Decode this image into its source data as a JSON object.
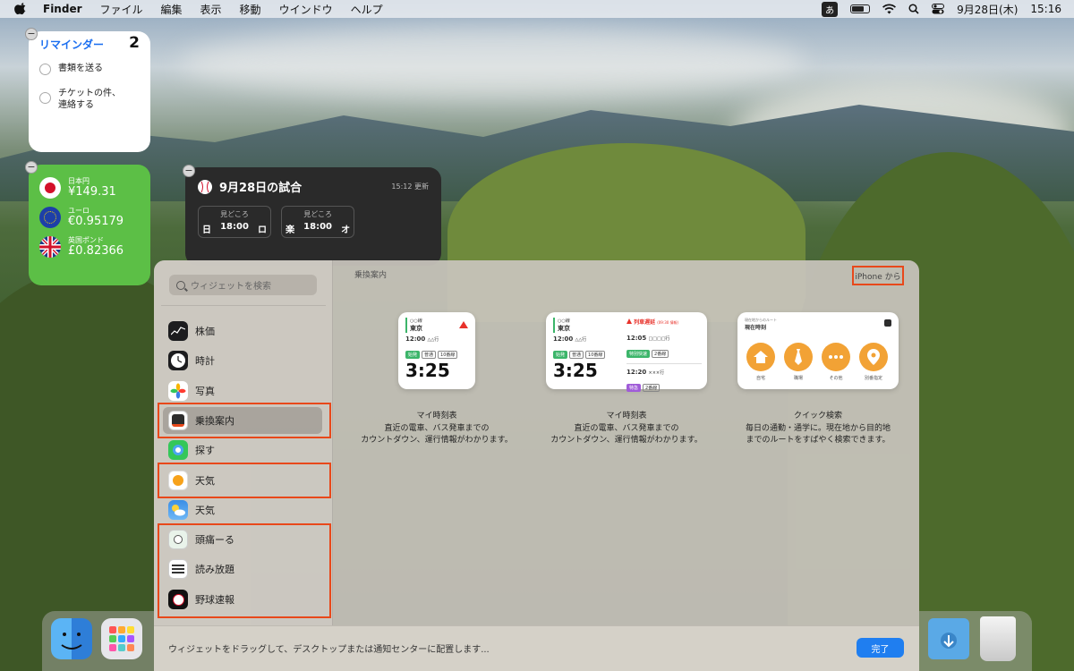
{
  "menubar": {
    "app_name": "Finder",
    "menus": [
      "ファイル",
      "編集",
      "表示",
      "移動",
      "ウインドウ",
      "ヘルプ"
    ],
    "ime": "あ",
    "date": "9月28日(木)",
    "time": "15:16"
  },
  "reminders_widget": {
    "title": "リマインダー",
    "count": "2",
    "items": [
      "書類を送る",
      "チケットの件、\n連絡する"
    ]
  },
  "currency_widget": {
    "rows": [
      {
        "name": "日本円",
        "value": "¥149.31"
      },
      {
        "name": "ユーロ",
        "value": "€0.95179"
      },
      {
        "name": "英国ポンド",
        "value": "£0.82366"
      }
    ]
  },
  "baseball_widget": {
    "title": "9月28日の試合",
    "updated": "15:12 更新",
    "matches": [
      {
        "label": "見どころ",
        "team1": "日",
        "time": "18:00",
        "team2": "ロ"
      },
      {
        "label": "見どころ",
        "team1": "楽",
        "time": "18:00",
        "team2": "オ"
      }
    ]
  },
  "gallery": {
    "search_placeholder": "ウィジェットを検索",
    "sidebar": [
      {
        "label": "株価",
        "icon": "stocks-icon",
        "color": "#1c1c1e"
      },
      {
        "label": "時計",
        "icon": "clock-icon",
        "color": "#1c1c1e"
      },
      {
        "label": "写真",
        "icon": "photos-icon",
        "color": "#ffffff"
      },
      {
        "label": "乗換案内",
        "icon": "transit-icon",
        "color": "#2d2d2d"
      },
      {
        "label": "探す",
        "icon": "findmy-icon",
        "color": "#34c759"
      },
      {
        "label": "天気",
        "icon": "yahoo-weather-icon",
        "color": "#ffffff"
      },
      {
        "label": "天気",
        "icon": "weather-icon",
        "color": "#3a8ee6"
      },
      {
        "label": "頭痛ーる",
        "icon": "zutool-icon",
        "color": "#e9f3ea"
      },
      {
        "label": "読み放題",
        "icon": "yomihodai-icon",
        "color": "#ffffff"
      },
      {
        "label": "野球速報",
        "icon": "baseball-news-icon",
        "color": "#111111"
      }
    ],
    "section_title": "乗換案内",
    "source_button": "iPhone から",
    "previews": [
      {
        "title": "マイ時刻表",
        "desc1": "直近の電車、バス発車までの",
        "desc2": "カウントダウン、運行情報がわかります。",
        "station_sub": "○○線",
        "station": "東京",
        "dep": "12:00",
        "dest": "△△行",
        "countdown": "3:25",
        "tags": [
          "始発",
          "普通",
          "10番線"
        ]
      },
      {
        "title": "マイ時刻表",
        "desc1": "直近の電車、バス発車までの",
        "desc2": "カウントダウン、運行情報がわかります。",
        "station_sub": "○○線",
        "station": "東京",
        "dep": "12:00",
        "dest": "△△行",
        "countdown": "3:25",
        "alert": "列車遅延",
        "alert_time": "(09:30 情報)",
        "next1": "12:05",
        "next1_dest": "□□□□行",
        "next1_tags": [
          "特別快速",
          "2番線"
        ],
        "next2": "12:20",
        "next2_dest": "×××行",
        "next2_tags": [
          "特急",
          "2番線"
        ],
        "tags": [
          "始発",
          "普通",
          "10番線"
        ]
      },
      {
        "title": "クイック検索",
        "desc1": "毎日の通勤・通学に。現在地から目的地",
        "desc2": "までのルートをすばやく検索できます。",
        "header_sub": "現在地からのルート",
        "header": "現在時刻",
        "buttons": [
          "自宅",
          "職場",
          "その他",
          "別番指定"
        ]
      }
    ],
    "hint": "ウィジェットをドラッグして、デスクトップまたは通知センターに配置します...",
    "done": "完了"
  },
  "colors": {
    "accent": "#1f7ef0",
    "highlight": "#e8481a",
    "currency_bg": "#5cbf46",
    "reminder_title": "#1a6ef0"
  }
}
